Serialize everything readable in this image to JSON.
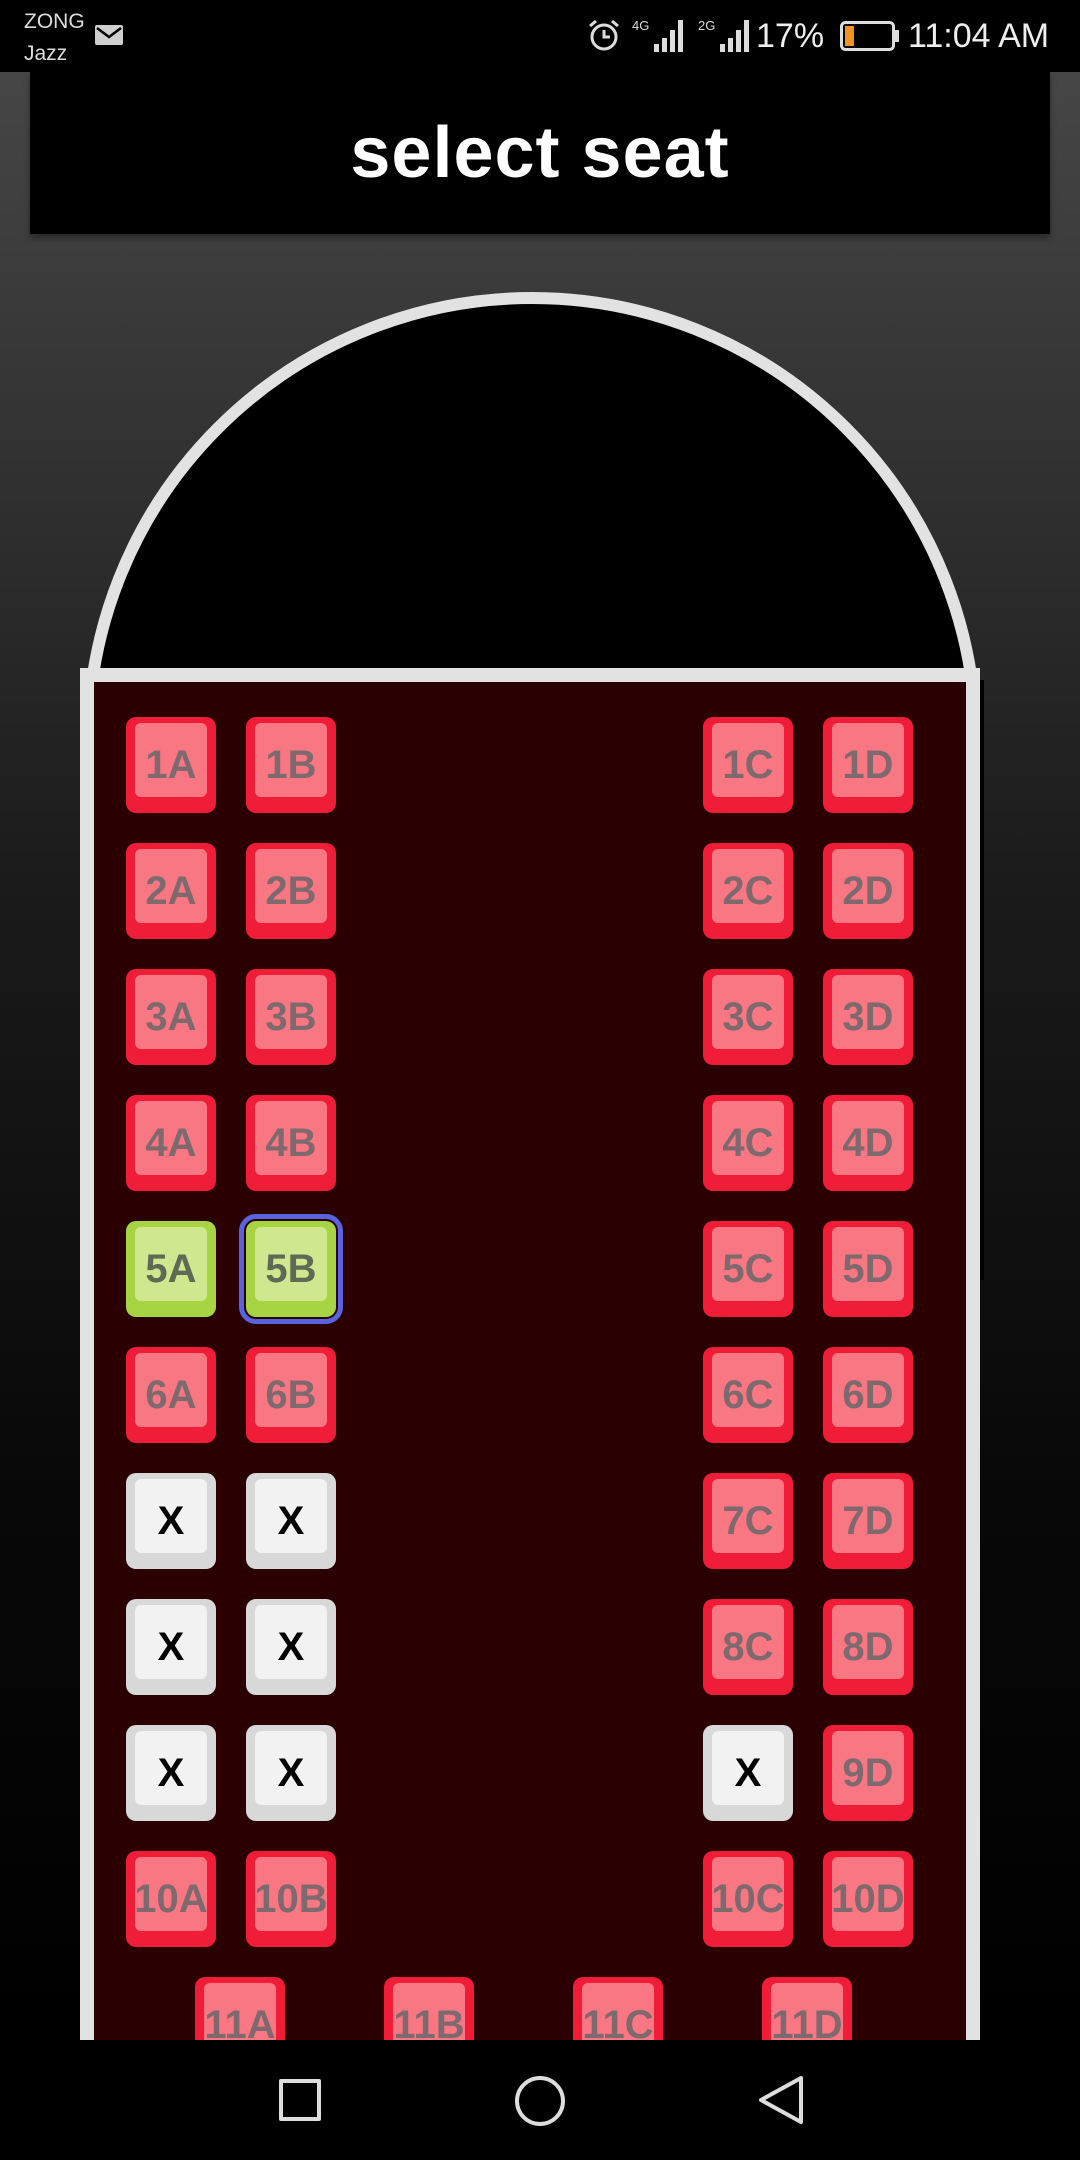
{
  "status_bar": {
    "carrier_line1": "ZONG",
    "carrier_line2": "Jazz",
    "network_1": "4G",
    "network_2": "2G",
    "battery": "17%",
    "battery_level": 0.17,
    "time": "11:04 AM",
    "icons": [
      "mail-icon",
      "alarm-icon",
      "signal-4g-icon",
      "signal-2g-icon",
      "battery-icon"
    ]
  },
  "header": {
    "title": "select seat"
  },
  "colors": {
    "seat_available": "#ef1d38",
    "seat_selected": "#a7d442",
    "seat_taken": "#d8d8d8",
    "cabin_floor": "#2a0002",
    "focus_ring": "#5a63de"
  },
  "seats": [
    {
      "label": "1A",
      "state": "available"
    },
    {
      "label": "1B",
      "state": "available"
    },
    {
      "label": "1C",
      "state": "available"
    },
    {
      "label": "1D",
      "state": "available"
    },
    {
      "label": "2A",
      "state": "available"
    },
    {
      "label": "2B",
      "state": "available"
    },
    {
      "label": "2C",
      "state": "available"
    },
    {
      "label": "2D",
      "state": "available"
    },
    {
      "label": "3A",
      "state": "available"
    },
    {
      "label": "3B",
      "state": "available"
    },
    {
      "label": "3C",
      "state": "available"
    },
    {
      "label": "3D",
      "state": "available"
    },
    {
      "label": "4A",
      "state": "available"
    },
    {
      "label": "4B",
      "state": "available"
    },
    {
      "label": "4C",
      "state": "available"
    },
    {
      "label": "4D",
      "state": "available"
    },
    {
      "label": "5A",
      "state": "selected"
    },
    {
      "label": "5B",
      "state": "selected",
      "focused": true
    },
    {
      "label": "5C",
      "state": "available"
    },
    {
      "label": "5D",
      "state": "available"
    },
    {
      "label": "6A",
      "state": "available"
    },
    {
      "label": "6B",
      "state": "available"
    },
    {
      "label": "6C",
      "state": "available"
    },
    {
      "label": "6D",
      "state": "available"
    },
    {
      "label": "X",
      "state": "taken"
    },
    {
      "label": "X",
      "state": "taken"
    },
    {
      "label": "7C",
      "state": "available"
    },
    {
      "label": "7D",
      "state": "available"
    },
    {
      "label": "X",
      "state": "taken"
    },
    {
      "label": "X",
      "state": "taken"
    },
    {
      "label": "8C",
      "state": "available"
    },
    {
      "label": "8D",
      "state": "available"
    },
    {
      "label": "X",
      "state": "taken"
    },
    {
      "label": "X",
      "state": "taken"
    },
    {
      "label": "X",
      "state": "taken"
    },
    {
      "label": "9D",
      "state": "available"
    },
    {
      "label": "10A",
      "state": "available"
    },
    {
      "label": "10B",
      "state": "available"
    },
    {
      "label": "10C",
      "state": "available"
    },
    {
      "label": "10D",
      "state": "available"
    },
    {
      "label": "11A",
      "state": "available"
    },
    {
      "label": "11B",
      "state": "available"
    },
    {
      "label": "11C",
      "state": "available"
    },
    {
      "label": "11D",
      "state": "available"
    }
  ],
  "nav_bar": [
    "recents-square-icon",
    "home-circle-icon",
    "back-triangle-icon"
  ]
}
